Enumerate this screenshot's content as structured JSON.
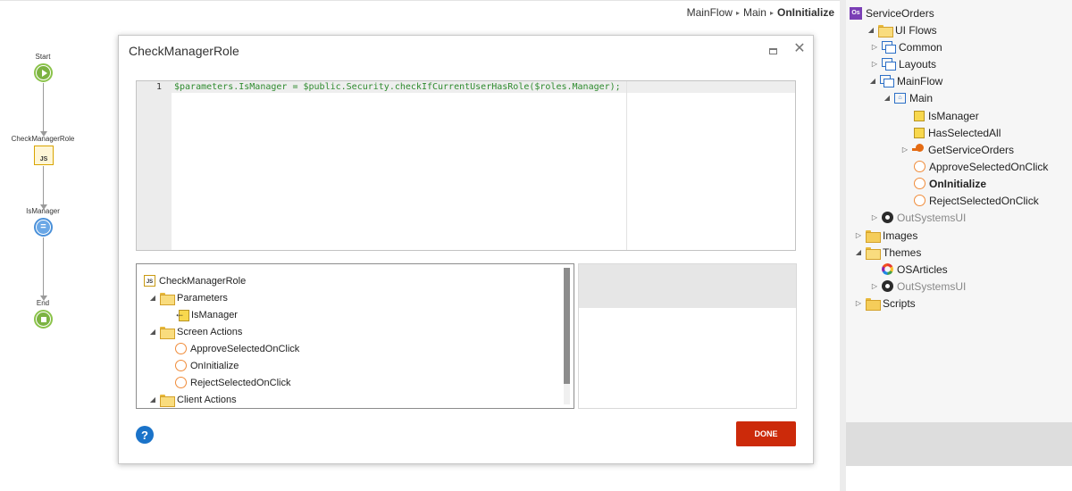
{
  "breadcrumb": {
    "flow": "MainFlow",
    "screen": "Main",
    "current": "OnInitialize",
    "separator": "▸"
  },
  "flow": {
    "start_label": "Start",
    "js_label": "CheckManagerRole",
    "js_icon_text": "JS",
    "assign_label": "IsManager",
    "assign_icon_text": "=",
    "end_label": "End"
  },
  "dialog": {
    "title": "CheckManagerRole",
    "editor": {
      "line_number": "1",
      "code": "$parameters.IsManager = $public.Security.checkIfCurrentUserHasRole($roles.Manager);"
    },
    "scope_tree": {
      "root": "CheckManagerRole",
      "parameters_folder": "Parameters",
      "parameter_item": "IsManager",
      "screen_actions_folder": "Screen Actions",
      "screen_actions": [
        "ApproveSelectedOnClick",
        "OnInitialize",
        "RejectSelectedOnClick"
      ],
      "client_actions_folder": "Client Actions"
    },
    "help_label": "?",
    "done_label": "DONE"
  },
  "tree": {
    "root": "ServiceOrders",
    "root_icon_text": "Os",
    "ui_flows": "UI Flows",
    "common": "Common",
    "layouts": "Layouts",
    "mainflow": "MainFlow",
    "main": "Main",
    "is_manager": "IsManager",
    "has_selected_all": "HasSelectedAll",
    "get_service_orders": "GetServiceOrders",
    "approve": "ApproveSelectedOnClick",
    "on_initialize": "OnInitialize",
    "reject": "RejectSelectedOnClick",
    "outsystems_ui_1": "OutSystemsUI",
    "images": "Images",
    "themes": "Themes",
    "os_articles": "OSArticles",
    "outsystems_ui_2": "OutSystemsUI",
    "scripts": "Scripts"
  },
  "colors": {
    "done_button": "#cc2a0a",
    "help_button": "#1a73c9",
    "code_text": "#2e8b2e",
    "start_end_node": "#7cb342",
    "assign_node": "#6aa7e6"
  },
  "icons": [
    "folder-icon",
    "ui-flow-icon",
    "screen-icon",
    "variable-icon",
    "client-action-icon",
    "aggregate-icon",
    "module-icon",
    "theme-icon",
    "javascript-icon",
    "input-parameter-icon"
  ]
}
